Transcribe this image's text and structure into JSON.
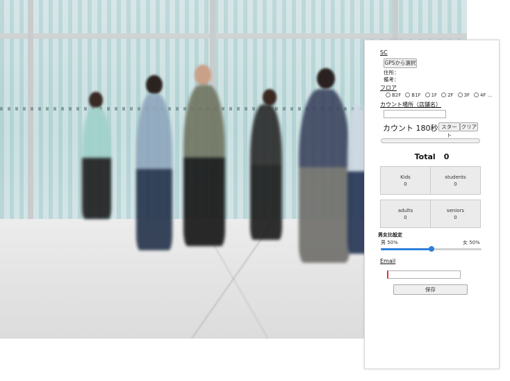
{
  "panel": {
    "sc_label": "SC",
    "gps_button": "GPSから選択",
    "address_label": "住所：",
    "remarks_label": "備考：",
    "floor_label": "フロア",
    "floor_options": [
      "B2F",
      "B1F",
      "1F",
      "2F",
      "3F",
      "4F ..."
    ],
    "count_place_label": "カウント場所（店舗名）",
    "count_place_value": "",
    "count_text": "カウント 180秒",
    "start_button": "スタート",
    "clear_button": "クリア",
    "progress": 0,
    "total_label": "Total",
    "total_value": "0",
    "tiles": [
      {
        "name": "Kids",
        "value": "0"
      },
      {
        "name": "students",
        "value": "0"
      },
      {
        "name": "adults",
        "value": "0"
      },
      {
        "name": "seniors",
        "value": "0"
      }
    ],
    "gender_title": "男女比設定",
    "male_label": "男 50%",
    "female_label": "女 50%",
    "gender_ratio": 0.5,
    "email_label": "Email",
    "email_value": "",
    "save_button": "保存"
  },
  "colors": {
    "accent": "#2f7fd9",
    "email_border": "#e03030"
  }
}
